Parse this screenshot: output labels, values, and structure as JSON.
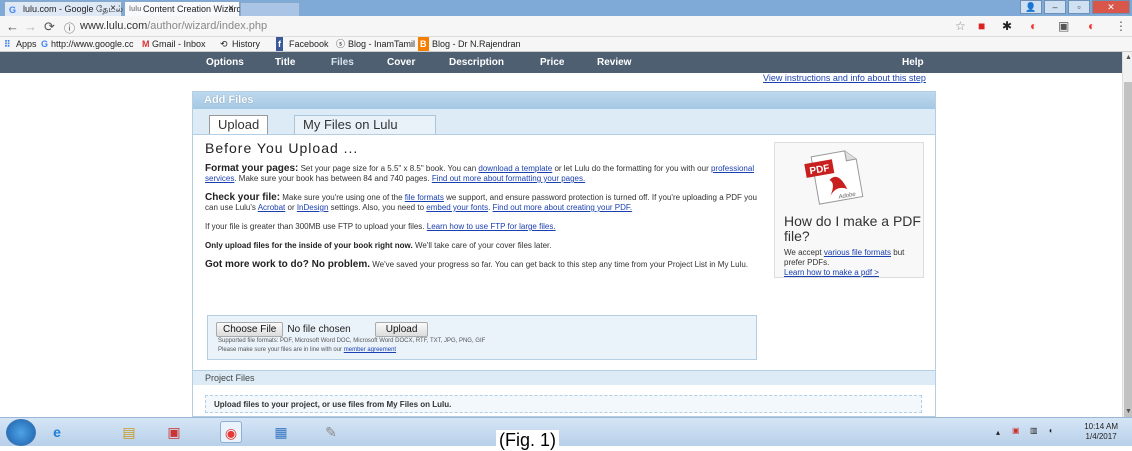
{
  "browser": {
    "tabs": [
      {
        "icon": "G",
        "label": "lulu.com - Google தேடல்"
      },
      {
        "icon": "lulu",
        "label": "Content Creation Wizard"
      }
    ],
    "url_host": "www.lulu.com",
    "url_path": "/author/wizard/index.php",
    "bookmarks": [
      "Apps",
      "http://www.google.cc",
      "Gmail - Inbox",
      "History",
      "Facebook",
      "Blog - InamTamil",
      "Blog - Dr N.Rajendran"
    ]
  },
  "nav": {
    "items": [
      "Options",
      "Title",
      "Files",
      "Cover",
      "Description",
      "Price",
      "Review"
    ],
    "help": "Help",
    "instructions": "View instructions and info about this step"
  },
  "panel": {
    "title": "Add Files",
    "tabs": [
      "Upload",
      "My Files on Lulu"
    ],
    "heading": "Before You Upload ...",
    "format": {
      "bold": "Format your pages:",
      "t1": " Set your page size for a 5.5\" x 8.5\" book. You can ",
      "l1": "download a template",
      "t2": " or let Lulu do the formatting for you with our ",
      "l2": "professional services",
      "t3": ". Make sure your book has between 84 and 740 pages. ",
      "l3": "Find out more about formatting your pages."
    },
    "check": {
      "bold": "Check your file:",
      "t1": " Make sure you're using one of the ",
      "l1": "file formats",
      "t2": " we support, and ensure password protection is turned off. If you're uploading a PDF you can use Lulu's ",
      "l2": "Acrobat",
      "t3": " or ",
      "l3": "InDesign",
      "t4": " settings. Also, you need to ",
      "l4": "embed your fonts",
      "t5": ". ",
      "l5": "Find out more about creating your PDF."
    },
    "ftp": {
      "t1": "If your file is greater than 300MB use FTP to upload your files. ",
      "l1": "Learn how to use FTP for large files."
    },
    "inside": {
      "bold": "Only upload files for the inside of your book right now.",
      "t1": " We'll take care of your cover files later."
    },
    "more": {
      "bold": "Got more work to do? No problem.",
      "t1": " We've saved your progress so far. You can get back to this step any time from your Project List in My Lulu."
    },
    "upload": {
      "choose": "Choose File",
      "nofile": "No file chosen",
      "button": "Upload",
      "supported": "Supported file formats: PDF, Microsoft Word DOC, Microsoft Word DOCX, RTF, TXT, JPG, PNG, GIF",
      "inline_t": "Please make sure your files are in line with our ",
      "inline_l": "member agreement"
    },
    "pdf": {
      "logo": "PDF",
      "adobe": "Adobe",
      "question": "How do I make a PDF file?",
      "t1": "We accept ",
      "l1": "various file formats",
      "t2": " but prefer PDFs.",
      "l2": "Learn how to make a pdf >"
    },
    "project_files": "Project Files",
    "project_hint": "Upload files to your project, or use files from My Files on Lulu."
  },
  "taskbar": {
    "time": "10:14 AM",
    "date": "1/4/2017"
  },
  "caption": "(Fig. 1)"
}
